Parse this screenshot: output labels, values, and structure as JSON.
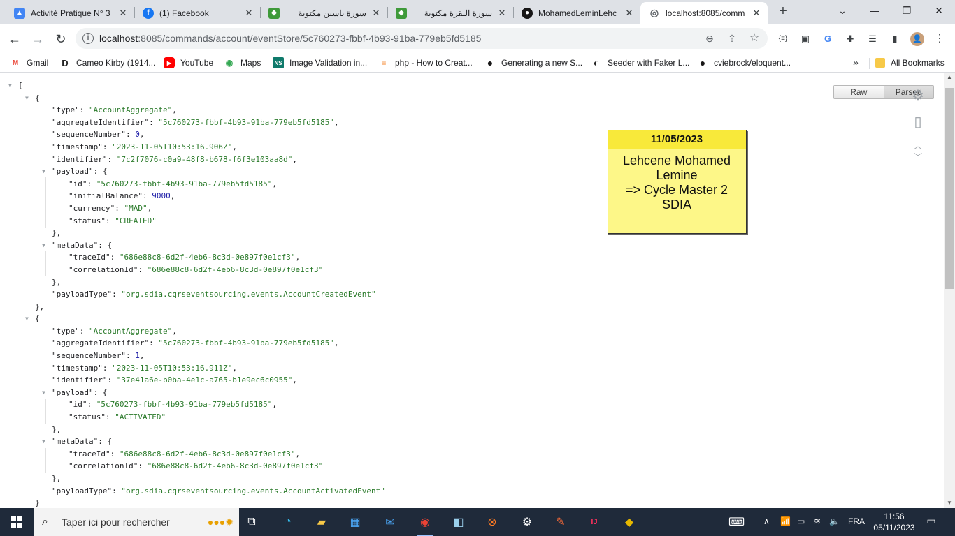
{
  "browser": {
    "tabs": [
      {
        "title": "Activité Pratique N° 3",
        "favicon": "classroom-icon",
        "color": "#4285f4",
        "glyph": "▲"
      },
      {
        "title": "(1) Facebook",
        "favicon": "facebook-icon",
        "color": "#1877f2",
        "glyph": "f"
      },
      {
        "title": "سورة ياسين مكتوبة",
        "favicon": "quran-book-icon",
        "color": "#3f9a3a",
        "glyph": "◆"
      },
      {
        "title": "سورة البقرة مكتوبة",
        "favicon": "quran-book-icon",
        "color": "#3f9a3a",
        "glyph": "◆"
      },
      {
        "title": "MohamedLeminLehc",
        "favicon": "github-icon",
        "color": "#181717",
        "glyph": "●"
      },
      {
        "title": "localhost:8085/comm",
        "favicon": "globe-icon",
        "color": "#5f6368",
        "glyph": "◎"
      }
    ],
    "close_glyph": "✕",
    "new_tab_glyph": "+",
    "window_controls": {
      "collapse": "⌄",
      "minimize": "—",
      "maximize": "❐",
      "close": "✕"
    },
    "url": {
      "host": "localhost",
      "rest": ":8085/commands/account/eventStore/5c760273-fbbf-4b93-91ba-779eb5fd5185"
    },
    "nav": {
      "back": "←",
      "forward": "→",
      "reload": "↻"
    },
    "omnibox_icons": {
      "zoom": "⊖",
      "share": "⇪",
      "star": "☆"
    },
    "extensions": [
      "{≡}",
      "▣",
      "G",
      "✚",
      "☰",
      "▮",
      "👤"
    ],
    "bookmarks": [
      {
        "label": "Gmail",
        "icon": "gmail-icon",
        "glyph": "M",
        "color": "#ea4335"
      },
      {
        "label": "Cameo Kirby (1914...",
        "icon": "d-logo-icon",
        "glyph": "D",
        "color": "#222222"
      },
      {
        "label": "YouTube",
        "icon": "youtube-icon",
        "glyph": "▶",
        "color": "#ff0000"
      },
      {
        "label": "Maps",
        "icon": "maps-icon",
        "glyph": "◉",
        "color": "#34a853"
      },
      {
        "label": "Image Validation in...",
        "icon": "ns-icon",
        "glyph": "NS",
        "color": "#0f7a6b"
      },
      {
        "label": "php - How to Creat...",
        "icon": "stackoverflow-icon",
        "glyph": "≡",
        "color": "#f48024"
      },
      {
        "label": "Generating a new S...",
        "icon": "github-icon",
        "glyph": "●",
        "color": "#181717"
      },
      {
        "label": "Seeder with Faker L...",
        "icon": "laracasts-icon",
        "glyph": "◐",
        "color": "#222222"
      },
      {
        "label": "cviebrock/eloquent...",
        "icon": "github-icon",
        "glyph": "●",
        "color": "#181717"
      }
    ],
    "bookmarks_more": "»",
    "all_bookmarks": "All Bookmarks"
  },
  "viewer": {
    "raw_label": "Raw",
    "parsed_label": "Parsed",
    "lines": [
      {
        "i": 0,
        "t": "[",
        "tog": true
      },
      {
        "i": 1,
        "t": "{",
        "tog": true
      },
      {
        "i": 2,
        "k": "type",
        "s": "AccountAggregate",
        "c": ","
      },
      {
        "i": 2,
        "k": "aggregateIdentifier",
        "s": "5c760273-fbbf-4b93-91ba-779eb5fd5185",
        "c": ","
      },
      {
        "i": 2,
        "k": "sequenceNumber",
        "n": "0",
        "c": ","
      },
      {
        "i": 2,
        "k": "timestamp",
        "s": "2023-11-05T10:53:16.906Z",
        "c": ","
      },
      {
        "i": 2,
        "k": "identifier",
        "s": "7c2f7076-c0a9-48f8-b678-f6f3e103aa8d",
        "c": ","
      },
      {
        "i": 2,
        "k": "payload",
        "o": "{",
        "tog": true
      },
      {
        "i": 3,
        "k": "id",
        "s": "5c760273-fbbf-4b93-91ba-779eb5fd5185",
        "c": ","
      },
      {
        "i": 3,
        "k": "initialBalance",
        "n": "9000",
        "c": ","
      },
      {
        "i": 3,
        "k": "currency",
        "s": "MAD",
        "c": ","
      },
      {
        "i": 3,
        "k": "status",
        "s": "CREATED",
        "c": ""
      },
      {
        "i": 2,
        "t": "},"
      },
      {
        "i": 2,
        "k": "metaData",
        "o": "{",
        "tog": true
      },
      {
        "i": 3,
        "k": "traceId",
        "s": "686e88c8-6d2f-4eb6-8c3d-0e897f0e1cf3",
        "c": ","
      },
      {
        "i": 3,
        "k": "correlationId",
        "s": "686e88c8-6d2f-4eb6-8c3d-0e897f0e1cf3",
        "c": ""
      },
      {
        "i": 2,
        "t": "},"
      },
      {
        "i": 2,
        "k": "payloadType",
        "s": "org.sdia.cqrseventsourcing.events.AccountCreatedEvent",
        "c": ""
      },
      {
        "i": 1,
        "t": "},"
      },
      {
        "i": 1,
        "t": "{",
        "tog": true
      },
      {
        "i": 2,
        "k": "type",
        "s": "AccountAggregate",
        "c": ","
      },
      {
        "i": 2,
        "k": "aggregateIdentifier",
        "s": "5c760273-fbbf-4b93-91ba-779eb5fd5185",
        "c": ","
      },
      {
        "i": 2,
        "k": "sequenceNumber",
        "n": "1",
        "c": ","
      },
      {
        "i": 2,
        "k": "timestamp",
        "s": "2023-11-05T10:53:16.911Z",
        "c": ","
      },
      {
        "i": 2,
        "k": "identifier",
        "s": "37e41a6e-b0ba-4e1c-a765-b1e9ec6c0955",
        "c": ","
      },
      {
        "i": 2,
        "k": "payload",
        "o": "{",
        "tog": true
      },
      {
        "i": 3,
        "k": "id",
        "s": "5c760273-fbbf-4b93-91ba-779eb5fd5185",
        "c": ","
      },
      {
        "i": 3,
        "k": "status",
        "s": "ACTIVATED",
        "c": ""
      },
      {
        "i": 2,
        "t": "},"
      },
      {
        "i": 2,
        "k": "metaData",
        "o": "{",
        "tog": true
      },
      {
        "i": 3,
        "k": "traceId",
        "s": "686e88c8-6d2f-4eb6-8c3d-0e897f0e1cf3",
        "c": ","
      },
      {
        "i": 3,
        "k": "correlationId",
        "s": "686e88c8-6d2f-4eb6-8c3d-0e897f0e1cf3",
        "c": ""
      },
      {
        "i": 2,
        "t": "},"
      },
      {
        "i": 2,
        "k": "payloadType",
        "s": "org.sdia.cqrseventsourcing.events.AccountActivatedEvent",
        "c": ""
      },
      {
        "i": 1,
        "t": "}"
      }
    ]
  },
  "sticky_note": {
    "date": "11/05/2023",
    "line1": "Lehcene Mohamed",
    "line2": "Lemine",
    "line3": "=> Cycle Master 2",
    "line4": "SDIA"
  },
  "taskbar": {
    "search_placeholder": "Taper ici pour rechercher",
    "language": "FRA",
    "time": "11:56",
    "date": "05/11/2023",
    "apps": [
      {
        "name": "task-view-icon",
        "glyph": "⧉",
        "color": "#ffffff"
      },
      {
        "name": "edge-icon",
        "glyph": "◔",
        "color": "#35c1f1"
      },
      {
        "name": "file-explorer-icon",
        "glyph": "▰",
        "color": "#f7c948"
      },
      {
        "name": "store-icon",
        "glyph": "▦",
        "color": "#4aa3f0"
      },
      {
        "name": "mail-icon",
        "glyph": "✉",
        "color": "#4aa3f0"
      },
      {
        "name": "chrome-icon",
        "glyph": "◉",
        "color": "#ea4335"
      },
      {
        "name": "notes-app-icon",
        "glyph": "◧",
        "color": "#9ad0ec"
      },
      {
        "name": "xampp-icon",
        "glyph": "⊗",
        "color": "#fb7a24"
      },
      {
        "name": "settings-icon",
        "glyph": "⚙",
        "color": "#ffffff"
      },
      {
        "name": "postman-icon",
        "glyph": "✎",
        "color": "#ff6c37"
      },
      {
        "name": "intellij-icon",
        "glyph": "IJ",
        "color": "#fe315d"
      },
      {
        "name": "git-icon",
        "glyph": "◆",
        "color": "#e6b800"
      }
    ],
    "tray": {
      "keyboard": "⌨",
      "chevron": "∧",
      "network": "📶",
      "battery": "▭",
      "wifi": "≋",
      "volume": "🔈"
    }
  }
}
